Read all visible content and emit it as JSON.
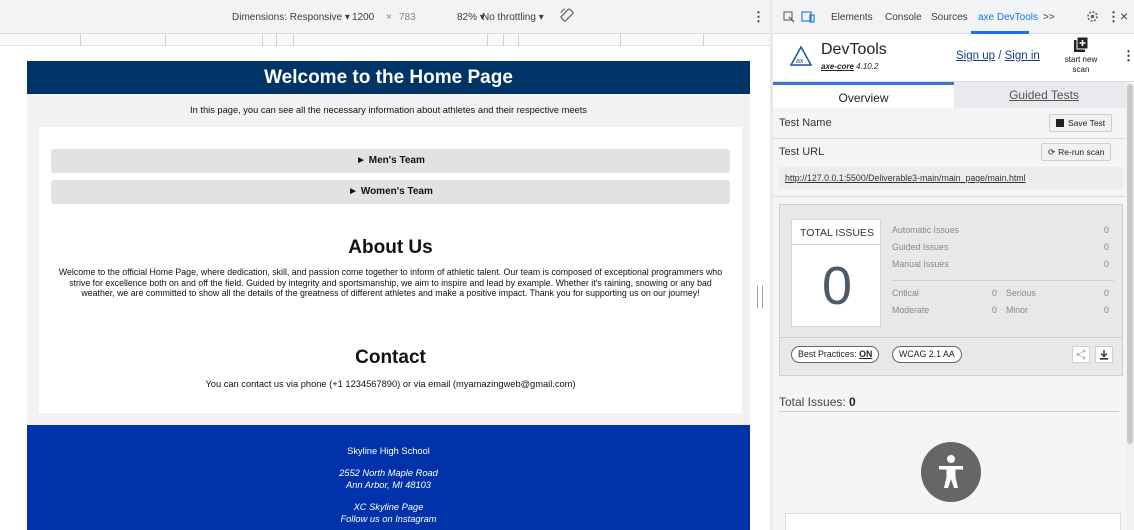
{
  "devtools_toolbar": {
    "dimensions_label": "Dimensions: Responsive ▾",
    "width": "1200",
    "times": "×",
    "height": "783",
    "zoom": "82% ▾",
    "throttle": "No throttling ▾",
    "kebab": "⋮"
  },
  "page": {
    "header_title": "Welcome to the Home Page",
    "intro": "In this page, you can see all the necessary information about athletes and their respective meets",
    "mens_team": "► Men's Team",
    "womens_team": "► Women's Team",
    "about_title": "About Us",
    "about_text": "Welcome to the official Home Page, where dedication, skill, and passion come together to inform of athletic talent. Our team is composed of exceptional programmers who strive for excellence both on and off the field. Guided by integrity and sportsmanship, we aim to inspire and lead by example. Whether it's raining, snowing or any bad weather, we are committed to show all the details of the greatness of different athletes and make a positive impact. Thank you for supporting us on our journey!",
    "contact_title": "Contact",
    "contact_text": "You can contact us via phone (+1 1234567890) or via email (myamazingweb@gmail.com)",
    "footer": {
      "school": "Skyline High School",
      "address1": "2552 North Maple Road",
      "address2": "Ann Arbor, MI 48103",
      "xc_page": "XC Skyline Page",
      "instagram": "Follow us on Instagram"
    }
  },
  "devtools_tabs": {
    "elements": "Elements",
    "console": "Console",
    "sources": "Sources",
    "axe": "axe DevTools",
    "more": ">>",
    "kebab": "⋮",
    "close": "×"
  },
  "axe": {
    "title": "DevTools",
    "core_label": "axe-core",
    "core_version": "4.10.2",
    "sign_up": "Sign up",
    "slash": "/",
    "sign_in": "Sign in",
    "start_new_scan_1": "start new",
    "start_new_scan_2": "scan",
    "kebab": "⋮",
    "tab_overview": "Overview",
    "tab_guided": "Guided Tests",
    "test_name_label": "Test Name",
    "save_test": "Save Test",
    "test_url_label": "Test URL",
    "rerun_scan": "Re-run scan",
    "test_url": "http://127.0.0.1:5500/Deliverable3-main/main_page/main.html",
    "total_issues_label": "TOTAL ISSUES",
    "total_issues_value": "0",
    "automatic_issues": "Automatic Issues",
    "automatic_value": "0",
    "guided_issues": "Guided Issues",
    "guided_value": "0",
    "manual_issues": "Manual Issues",
    "manual_value": "0",
    "critical": "Critical",
    "critical_value": "0",
    "serious": "Serious",
    "serious_value": "0",
    "moderate": "Moderate",
    "moderate_value": "0",
    "minor": "Minor",
    "minor_value": "0",
    "best_practices": "Best Practices:",
    "best_practices_state": "ON",
    "wcag": "WCAG 2.1 AA",
    "total_issues_footer_label": "Total Issues:",
    "total_issues_footer_value": "0"
  },
  "colors": {
    "header_bg": "#003366",
    "footer_bg": "#0033aa",
    "accent": "#1a73e8"
  }
}
